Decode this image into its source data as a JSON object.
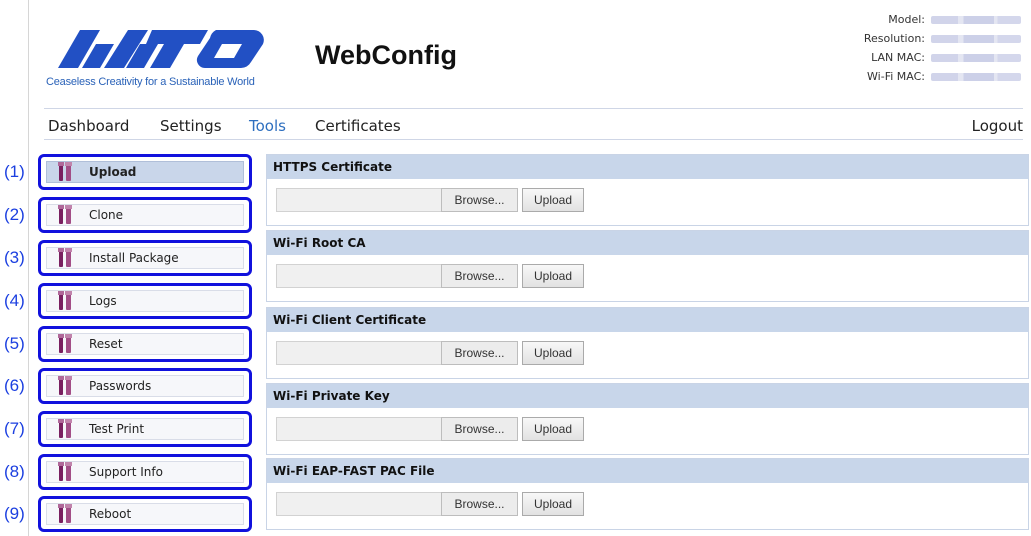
{
  "header": {
    "logo_text": "SATO",
    "tagline": "Ceaseless Creativity for a Sustainable World",
    "app_title": "WebConfig",
    "info": [
      {
        "label": "Model:"
      },
      {
        "label": "Resolution:"
      },
      {
        "label": "LAN MAC:"
      },
      {
        "label": "Wi-Fi MAC:"
      }
    ]
  },
  "nav": {
    "items": [
      "Dashboard",
      "Settings",
      "Tools",
      "Certificates"
    ],
    "active": "Tools",
    "logout": "Logout"
  },
  "sidebar": {
    "items": [
      {
        "num": "(1)",
        "label": "Upload",
        "selected": true
      },
      {
        "num": "(2)",
        "label": "Clone"
      },
      {
        "num": "(3)",
        "label": "Install Package"
      },
      {
        "num": "(4)",
        "label": "Logs"
      },
      {
        "num": "(5)",
        "label": "Reset"
      },
      {
        "num": "(6)",
        "label": "Passwords"
      },
      {
        "num": "(7)",
        "label": "Test Print"
      },
      {
        "num": "(8)",
        "label": "Support Info"
      },
      {
        "num": "(9)",
        "label": "Reboot"
      }
    ]
  },
  "sections": [
    {
      "title": "HTTPS Certificate",
      "browse": "Browse...",
      "upload": "Upload"
    },
    {
      "title": "Wi-Fi Root CA",
      "browse": "Browse...",
      "upload": "Upload"
    },
    {
      "title": "Wi-Fi Client Certificate",
      "browse": "Browse...",
      "upload": "Upload"
    },
    {
      "title": "Wi-Fi Private Key",
      "browse": "Browse...",
      "upload": "Upload"
    },
    {
      "title": "Wi-Fi EAP-FAST PAC File",
      "browse": "Browse...",
      "upload": "Upload"
    }
  ],
  "colors": {
    "brand_blue": "#1f4fbf",
    "accent_nav": "#2e6fbf",
    "callout_border": "#1111dd",
    "section_header": "#c8d6ea",
    "icon": "#8a2a6e"
  }
}
